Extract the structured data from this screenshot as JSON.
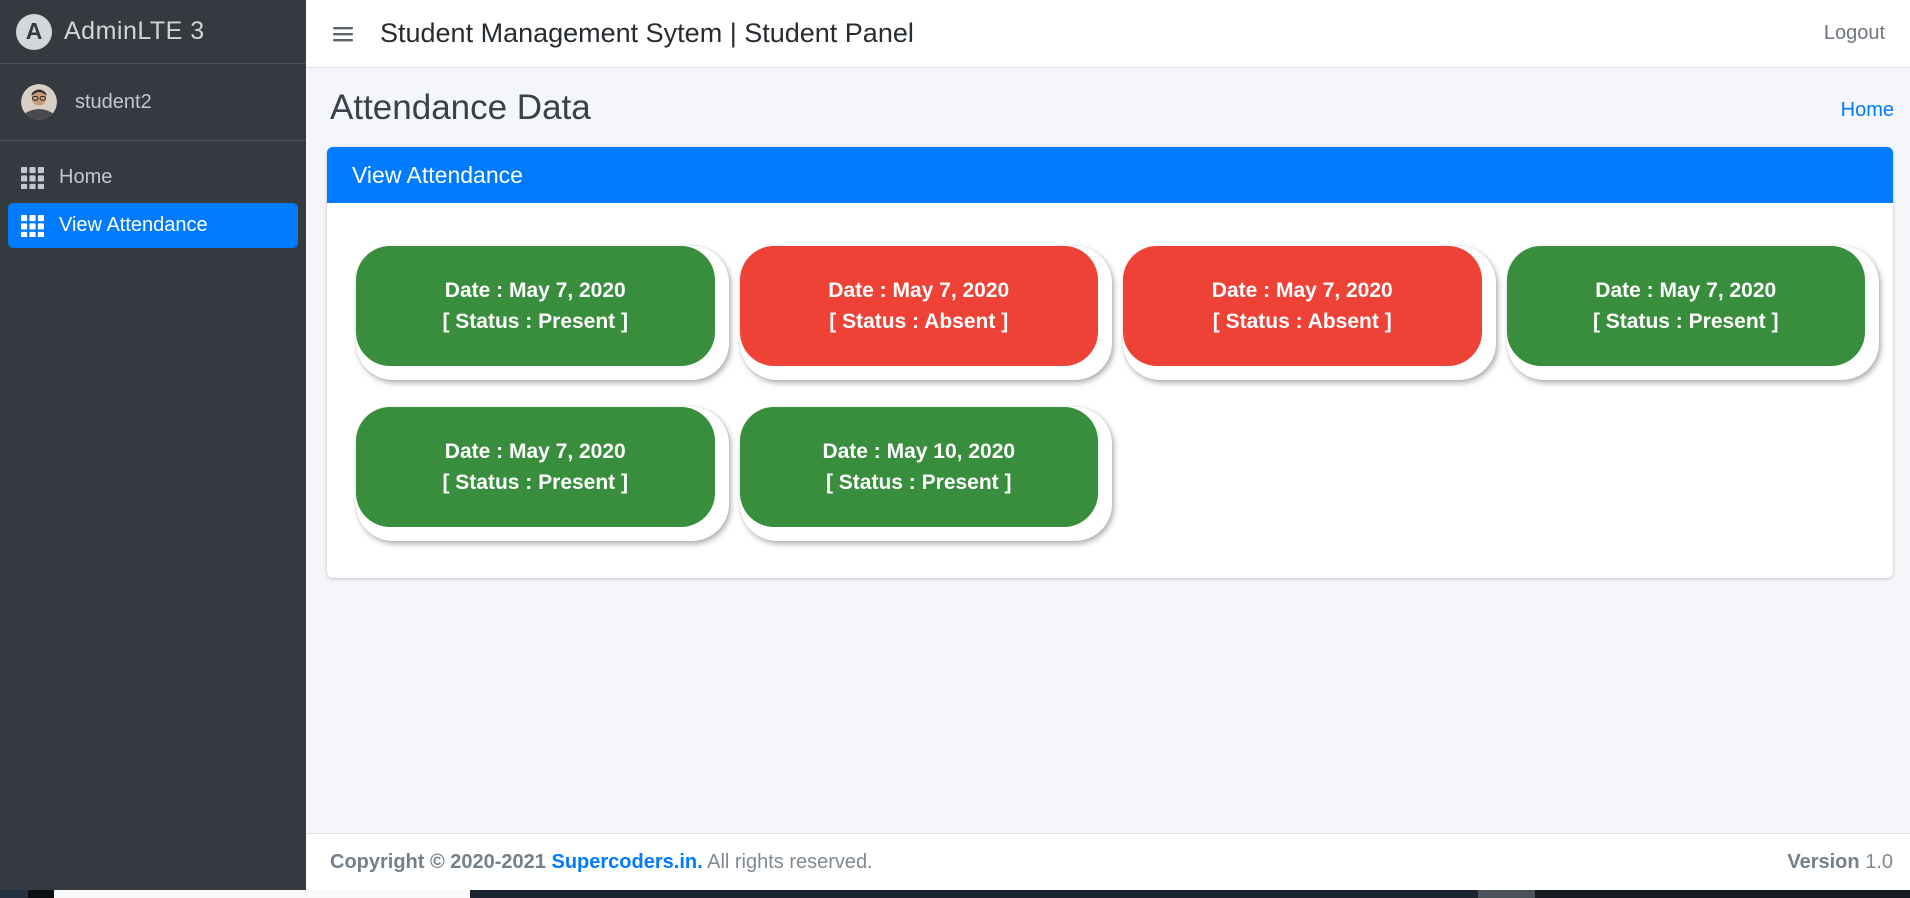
{
  "app": {
    "brand": "AdminLTE 3",
    "user": "student2"
  },
  "sidebar": {
    "items": [
      {
        "label": "Home",
        "active": false
      },
      {
        "label": "View Attendance",
        "active": true
      }
    ]
  },
  "navbar": {
    "title": "Student Management Sytem | Student Panel",
    "logout": "Logout"
  },
  "page": {
    "title": "Attendance Data",
    "breadcrumb": "Home"
  },
  "card": {
    "header": "View Attendance"
  },
  "attendance": [
    {
      "date": "Date : May 7, 2020",
      "status": "[ Status : Present ]",
      "state": "present"
    },
    {
      "date": "Date : May 7, 2020",
      "status": "[ Status : Absent ]",
      "state": "absent"
    },
    {
      "date": "Date : May 7, 2020",
      "status": "[ Status : Absent ]",
      "state": "absent"
    },
    {
      "date": "Date : May 7, 2020",
      "status": "[ Status : Present ]",
      "state": "present"
    },
    {
      "date": "Date : May 7, 2020",
      "status": "[ Status : Present ]",
      "state": "present"
    },
    {
      "date": "Date : May 10, 2020",
      "status": "[ Status : Present ]",
      "state": "present"
    }
  ],
  "footer": {
    "copyright": "Copyright © 2020-2021",
    "link": "Supercoders.in.",
    "rights": "All rights reserved.",
    "version_label": "Version",
    "version_value": "1.0"
  },
  "colors": {
    "accent": "#007bff",
    "present": "#388e3c",
    "absent": "#ee4237",
    "sidebar": "#343a40"
  }
}
